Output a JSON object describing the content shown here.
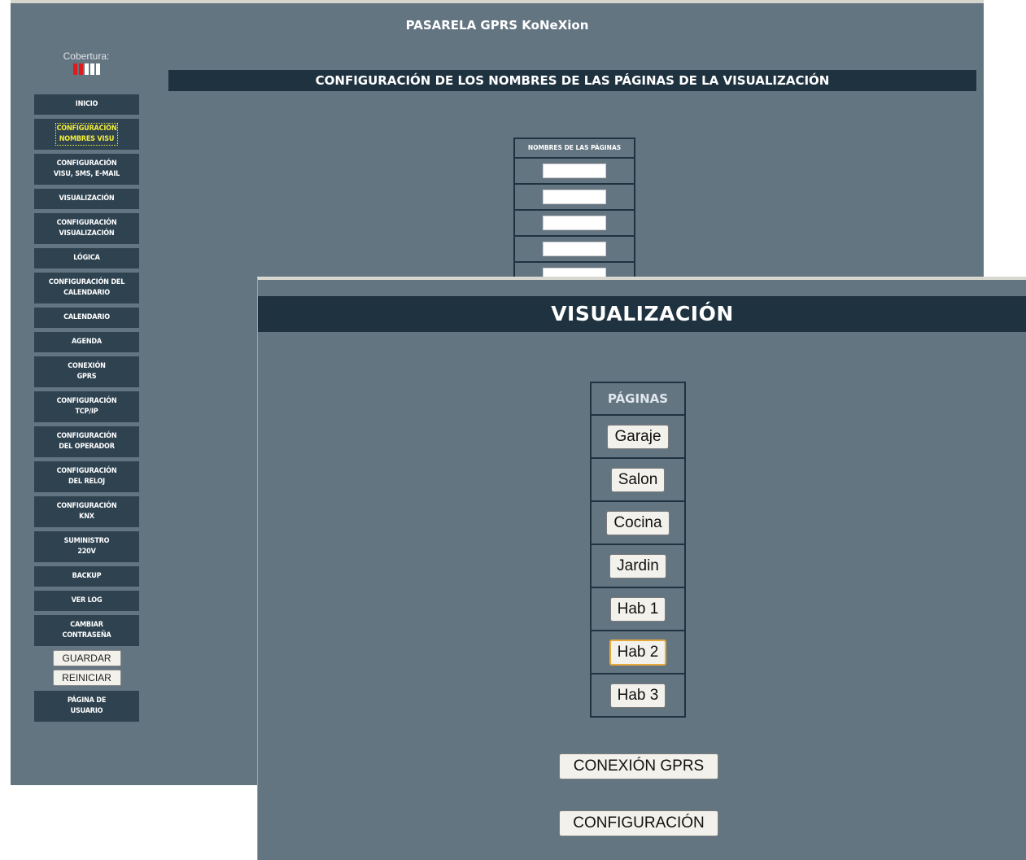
{
  "app_title": "PASARELA GPRS KoNeXion",
  "coverage": {
    "label": "Cobertura:",
    "bars_total": 5,
    "bars_red": 2,
    "red_color": "#e01b1b"
  },
  "sidebar": {
    "items": [
      {
        "label": "INICIO",
        "active": false
      },
      {
        "label": "CONFIGURACIÓN\nNOMBRES VISU",
        "active": true
      },
      {
        "label": "CONFIGURACIÓN\nVISU, SMS, E-MAIL",
        "active": false
      },
      {
        "label": "VISUALIZACIÓN",
        "active": false
      },
      {
        "label": "CONFIGURACIÓN\nVISUALIZACIÓN",
        "active": false
      },
      {
        "label": "LÓGICA",
        "active": false
      },
      {
        "label": "CONFIGURACIÓN DEL\nCALENDARIO",
        "active": false
      },
      {
        "label": "CALENDARIO",
        "active": false
      },
      {
        "label": "AGENDA",
        "active": false
      },
      {
        "label": "CONEXIÓN\nGPRS",
        "active": false
      },
      {
        "label": "CONFIGURACIÓN\nTCP/IP",
        "active": false
      },
      {
        "label": "CONFIGURACIÓN\nDEL OPERADOR",
        "active": false
      },
      {
        "label": "CONFIGURACIÓN\nDEL RELOJ",
        "active": false
      },
      {
        "label": "CONFIGURACIÓN\nKNX",
        "active": false
      },
      {
        "label": "SUMINISTRO\n220V",
        "active": false
      },
      {
        "label": "BACKUP",
        "active": false
      },
      {
        "label": "VER LOG",
        "active": false
      },
      {
        "label": "CAMBIAR\nCONTRASEÑA",
        "active": false
      }
    ],
    "save_label": "GUARDAR",
    "restart_label": "REINICIAR",
    "user_page_label": "PÁGINA DE\nUSUARIO"
  },
  "config": {
    "header": "CONFIGURACIÓN DE LOS NOMBRES DE LAS PÁGINAS DE LA VISUALIZACIÓN",
    "table_header": "NOMBRES DE LAS PÁGINAS",
    "inputs": [
      "",
      "",
      "",
      "",
      ""
    ]
  },
  "visu": {
    "header": "VISUALIZACIÓN",
    "pages_header": "PÁGINAS",
    "pages": [
      "Garaje",
      "Salon",
      "Cocina",
      "Jardin",
      "Hab 1",
      "Hab 2",
      "Hab 3"
    ],
    "focused_page": "Hab 2",
    "gprs_button": "CONEXIÓN GPRS",
    "config_button": "CONFIGURACIÓN"
  },
  "colors": {
    "panel_bg": "#647582",
    "header_bg": "#1f3240",
    "nav_bg": "#2e4250",
    "active_text": "#f4ee3a"
  }
}
